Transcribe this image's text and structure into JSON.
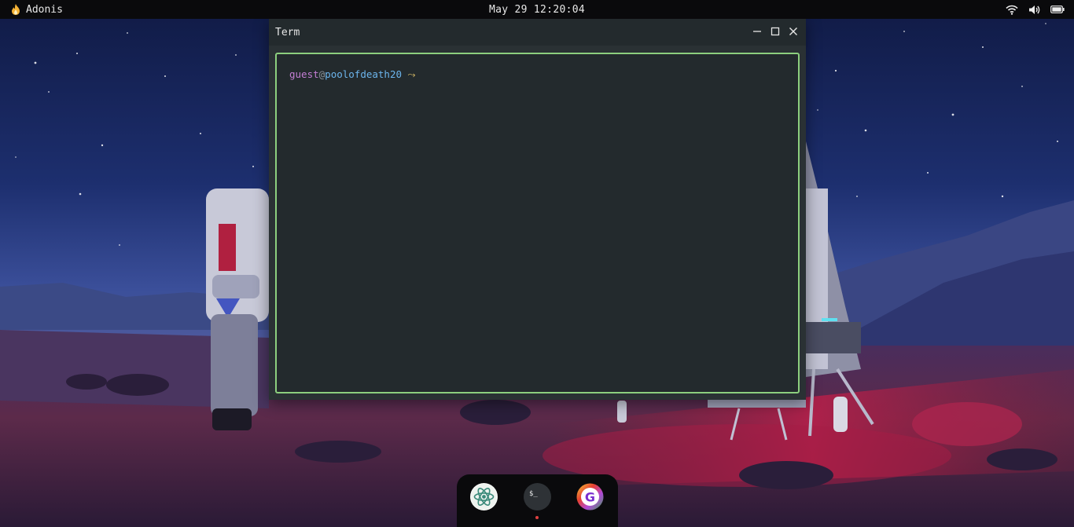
{
  "topbar": {
    "app_name": "Adonis",
    "app_icon": "flame-icon",
    "datetime": "May 29 12:20:04",
    "status_icons": [
      "wifi-icon",
      "volume-icon",
      "battery-icon"
    ]
  },
  "window": {
    "title": "Term",
    "controls": [
      "minimize-icon",
      "maximize-icon",
      "close-icon"
    ],
    "terminal": {
      "prompt_user": "guest",
      "prompt_at": "@",
      "prompt_host": "poolofdeath20",
      "prompt_arrow": " ⤳",
      "border_color": "#8ccf7e"
    }
  },
  "dock": {
    "items": [
      {
        "name": "atom-app",
        "icon": "atom-icon",
        "running": false
      },
      {
        "name": "terminal-app",
        "icon": "terminal-icon",
        "label": "$_",
        "running": true
      },
      {
        "name": "chrome-app",
        "icon": "google-g-icon",
        "running": false
      }
    ],
    "running_indicator_color": "#e04040"
  }
}
